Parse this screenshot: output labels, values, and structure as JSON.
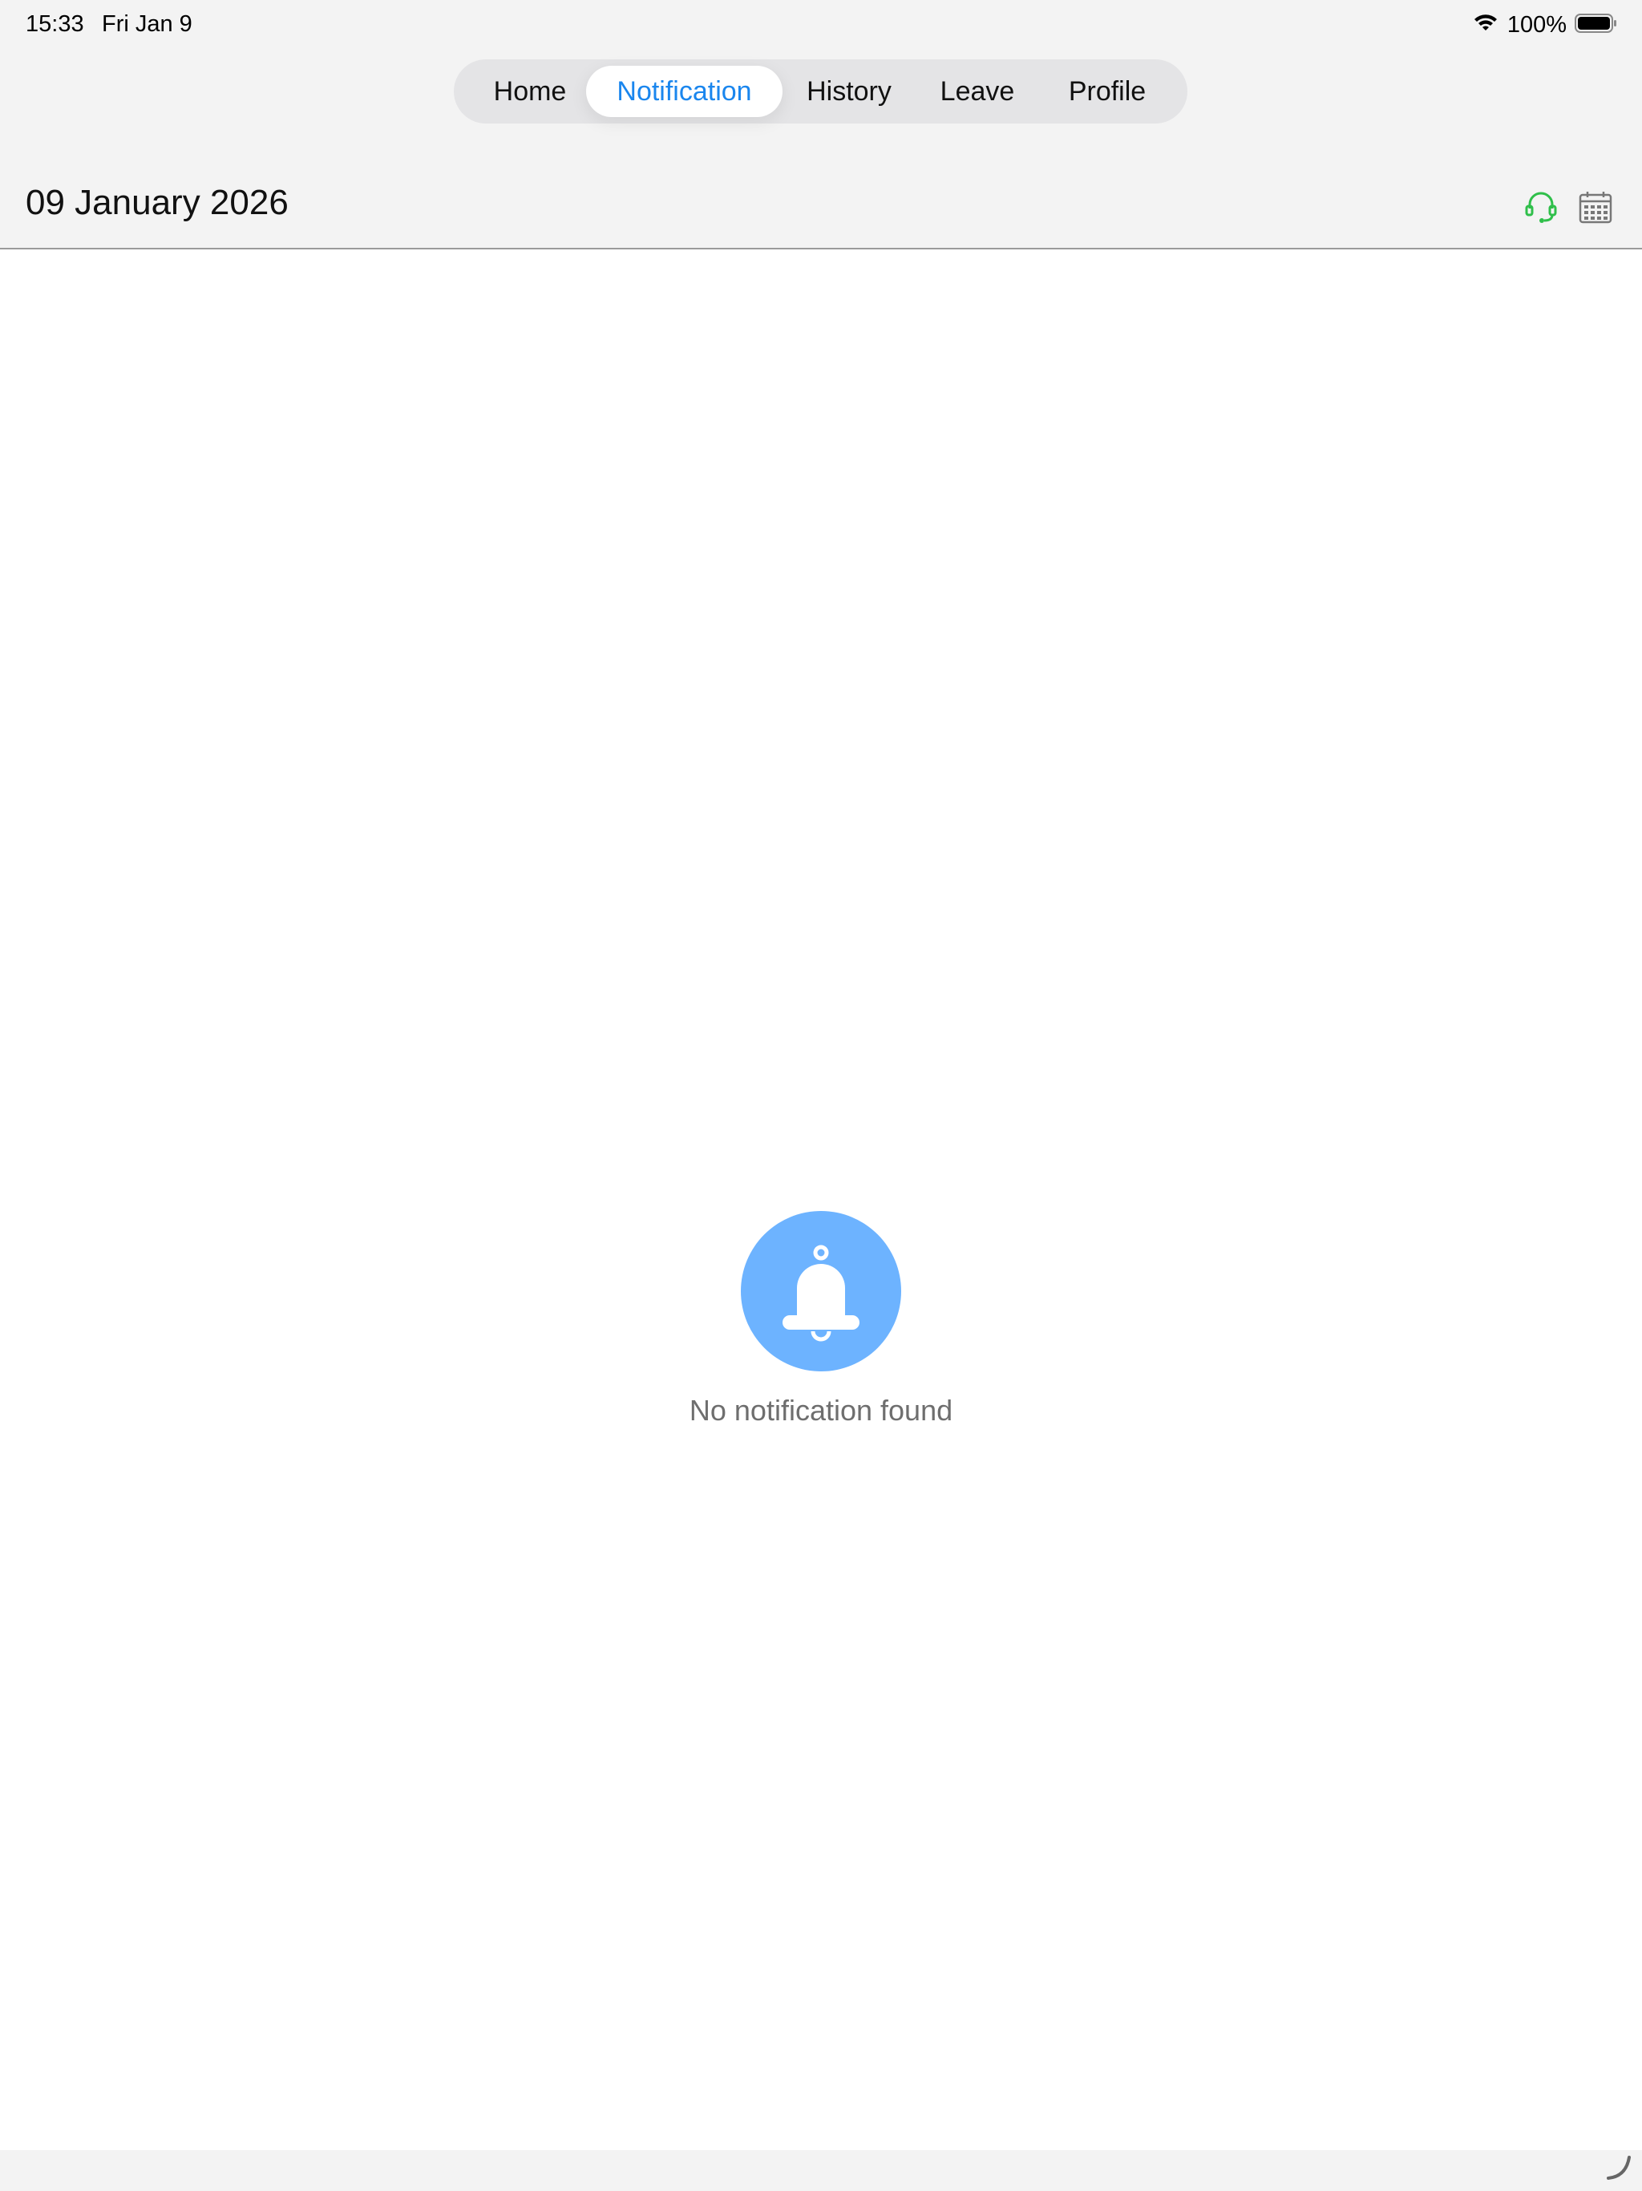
{
  "status_bar": {
    "time": "15:33",
    "date": "Fri Jan 9",
    "battery": "100%",
    "wifi_icon": "wifi-icon",
    "battery_icon": "battery-icon"
  },
  "tabs": [
    {
      "label": "Home",
      "active": false
    },
    {
      "label": "Notification",
      "active": true
    },
    {
      "label": "History",
      "active": false
    },
    {
      "label": "Leave",
      "active": false
    },
    {
      "label": "Profile",
      "active": false
    }
  ],
  "header": {
    "date": "09 January 2026",
    "support_icon": "headset-icon",
    "calendar_icon": "calendar-icon"
  },
  "empty_state": {
    "icon": "bell-icon",
    "message": "No notification found"
  },
  "colors": {
    "accent": "#1a86ee",
    "bell_bg": "#6db3ff",
    "support_icon": "#2fbf4a",
    "muted_text": "#6e6e6e",
    "tab_bar_bg": "#e4e4e6",
    "page_bg": "#f3f3f3"
  }
}
